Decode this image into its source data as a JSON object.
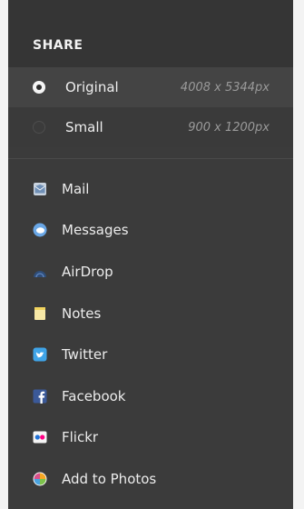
{
  "header": {
    "title": "SHARE"
  },
  "sizes": [
    {
      "label": "Original",
      "dimensions": "4008 x 5344px",
      "selected": true
    },
    {
      "label": "Small",
      "dimensions": "900 x 1200px",
      "selected": false
    }
  ],
  "share_items": [
    {
      "label": "Mail",
      "icon": "mail-icon"
    },
    {
      "label": "Messages",
      "icon": "messages-icon"
    },
    {
      "label": "AirDrop",
      "icon": "airdrop-icon"
    },
    {
      "label": "Notes",
      "icon": "notes-icon"
    },
    {
      "label": "Twitter",
      "icon": "twitter-icon"
    },
    {
      "label": "Facebook",
      "icon": "facebook-icon"
    },
    {
      "label": "Flickr",
      "icon": "flickr-icon"
    },
    {
      "label": "Add to Photos",
      "icon": "photos-icon"
    }
  ],
  "colors": {
    "panel": "#3b3b3b",
    "header": "#353535",
    "selected_row": "#444444",
    "text": "#ececec",
    "secondary_text": "#9a9a9a"
  }
}
